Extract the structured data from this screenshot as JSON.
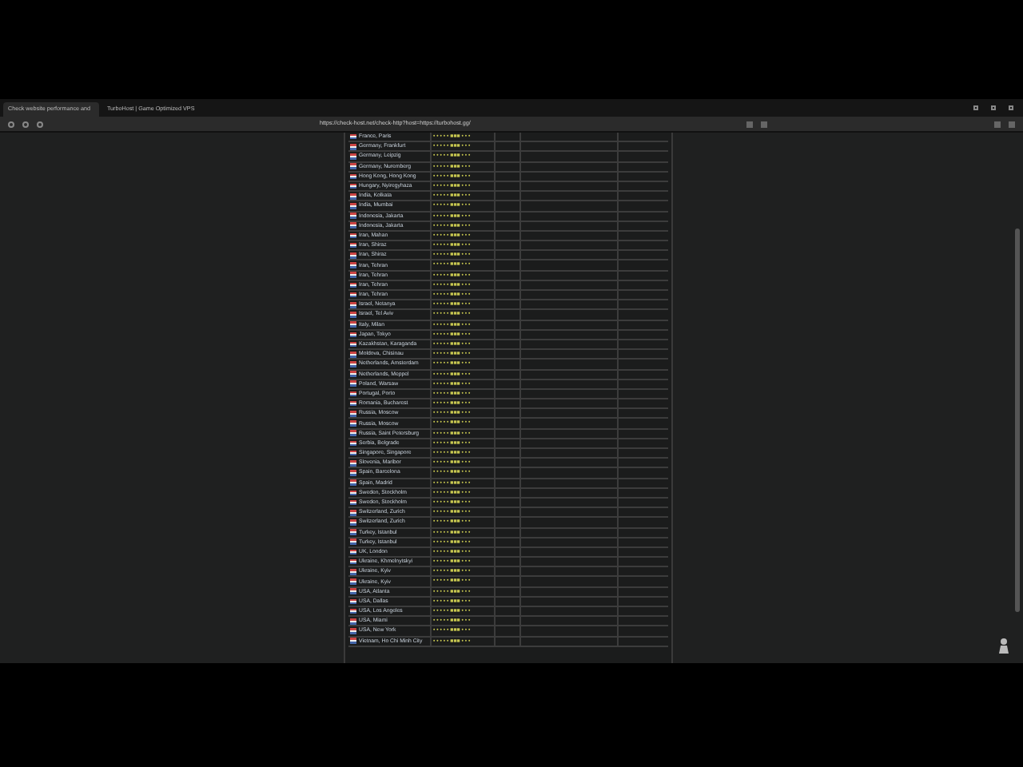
{
  "browser": {
    "tabs": [
      {
        "title": "Check website performance and",
        "selected": true
      },
      {
        "title": "TurboHost | Game Optimized VPS",
        "selected": false
      }
    ],
    "address": "https://check-host.net/check-http?host=https://turbohost.gg/"
  },
  "table": {
    "rows": [
      {
        "location": "France, Paris",
        "result": "• • • • • ■■■ • • •"
      },
      {
        "location": "Germany, Frankfurt",
        "result": "• • • • • ■■■ • • •"
      },
      {
        "location": "Germany, Leipzig",
        "result": "• • • • • ■■■ • • •"
      },
      {
        "location": "Germany, Nuremberg",
        "result": "• • • • • ■■■ • • •"
      },
      {
        "location": "Hong Kong, Hong Kong",
        "result": "• • • • • ■■■ • • •"
      },
      {
        "location": "Hungary, Nyiregyhaza",
        "result": "• • • • • ■■■ • • •"
      },
      {
        "location": "India, Kolkata",
        "result": "• • • • • ■■■ • • •"
      },
      {
        "location": "India, Mumbai",
        "result": "• • • • • ■■■ • • •"
      },
      {
        "location": "Indonesia, Jakarta",
        "result": "• • • • • ■■■ • • •"
      },
      {
        "location": "Indonesia, Jakarta",
        "result": "• • • • • ■■■ • • •"
      },
      {
        "location": "Iran, Mahan",
        "result": "• • • • • ■■■ • • •"
      },
      {
        "location": "Iran, Shiraz",
        "result": "• • • • • ■■■ • • •"
      },
      {
        "location": "Iran, Shiraz",
        "result": "• • • • • ■■■ • • •"
      },
      {
        "location": "Iran, Tehran",
        "result": "• • • • • ■■■ • • •"
      },
      {
        "location": "Iran, Tehran",
        "result": "• • • • • ■■■ • • •"
      },
      {
        "location": "Iran, Tehran",
        "result": "• • • • • ■■■ • • •"
      },
      {
        "location": "Iran, Tehran",
        "result": "• • • • • ■■■ • • •"
      },
      {
        "location": "Israel, Netanya",
        "result": "• • • • • ■■■ • • •"
      },
      {
        "location": "Israel, Tel Aviv",
        "result": "• • • • • ■■■ • • •"
      },
      {
        "location": "Italy, Milan",
        "result": "• • • • • ■■■ • • •"
      },
      {
        "location": "Japan, Tokyo",
        "result": "• • • • • ■■■ • • •"
      },
      {
        "location": "Kazakhstan, Karaganda",
        "result": "• • • • • ■■■ • • •"
      },
      {
        "location": "Moldova, Chisinau",
        "result": "• • • • • ■■■ • • •"
      },
      {
        "location": "Netherlands, Amsterdam",
        "result": "• • • • • ■■■ • • •"
      },
      {
        "location": "Netherlands, Meppel",
        "result": "• • • • • ■■■ • • •"
      },
      {
        "location": "Poland, Warsaw",
        "result": "• • • • • ■■■ • • •"
      },
      {
        "location": "Portugal, Porto",
        "result": "• • • • • ■■■ • • •"
      },
      {
        "location": "Romania, Bucharest",
        "result": "• • • • • ■■■ • • •"
      },
      {
        "location": "Russia, Moscow",
        "result": "• • • • • ■■■ • • •"
      },
      {
        "location": "Russia, Moscow",
        "result": "• • • • • ■■■ • • •"
      },
      {
        "location": "Russia, Saint Petersburg",
        "result": "• • • • • ■■■ • • •"
      },
      {
        "location": "Serbia, Belgrade",
        "result": "• • • • • ■■■ • • •"
      },
      {
        "location": "Singapore, Singapore",
        "result": "• • • • • ■■■ • • •"
      },
      {
        "location": "Slovenia, Maribor",
        "result": "• • • • • ■■■ • • •"
      },
      {
        "location": "Spain, Barcelona",
        "result": "• • • • • ■■■ • • •"
      },
      {
        "location": "Spain, Madrid",
        "result": "• • • • • ■■■ • • •"
      },
      {
        "location": "Sweden, Stockholm",
        "result": "• • • • • ■■■ • • •"
      },
      {
        "location": "Sweden, Stockholm",
        "result": "• • • • • ■■■ • • •"
      },
      {
        "location": "Switzerland, Zurich",
        "result": "• • • • • ■■■ • • •"
      },
      {
        "location": "Switzerland, Zurich",
        "result": "• • • • • ■■■ • • •"
      },
      {
        "location": "Turkey, Istanbul",
        "result": "• • • • • ■■■ • • •"
      },
      {
        "location": "Turkey, Istanbul",
        "result": "• • • • • ■■■ • • •"
      },
      {
        "location": "UK, London",
        "result": "• • • • • ■■■ • • •"
      },
      {
        "location": "Ukraine, Khmelnytskyi",
        "result": "• • • • • ■■■ • • •"
      },
      {
        "location": "Ukraine, Kyiv",
        "result": "• • • • • ■■■ • • •"
      },
      {
        "location": "Ukraine, Kyiv",
        "result": "• • • • • ■■■ • • •"
      },
      {
        "location": "USA, Atlanta",
        "result": "• • • • • ■■■ • • •"
      },
      {
        "location": "USA, Dallas",
        "result": "• • • • • ■■■ • • •"
      },
      {
        "location": "USA, Los Angeles",
        "result": "• • • • • ■■■ • • •"
      },
      {
        "location": "USA, Miami",
        "result": "• • • • • ■■■ • • •"
      },
      {
        "location": "USA, New York",
        "result": "• • • • • ■■■ • • •"
      },
      {
        "location": "Vietnam, Ho Chi Minh City",
        "result": "• • • • • ■■■ • • •"
      }
    ]
  }
}
